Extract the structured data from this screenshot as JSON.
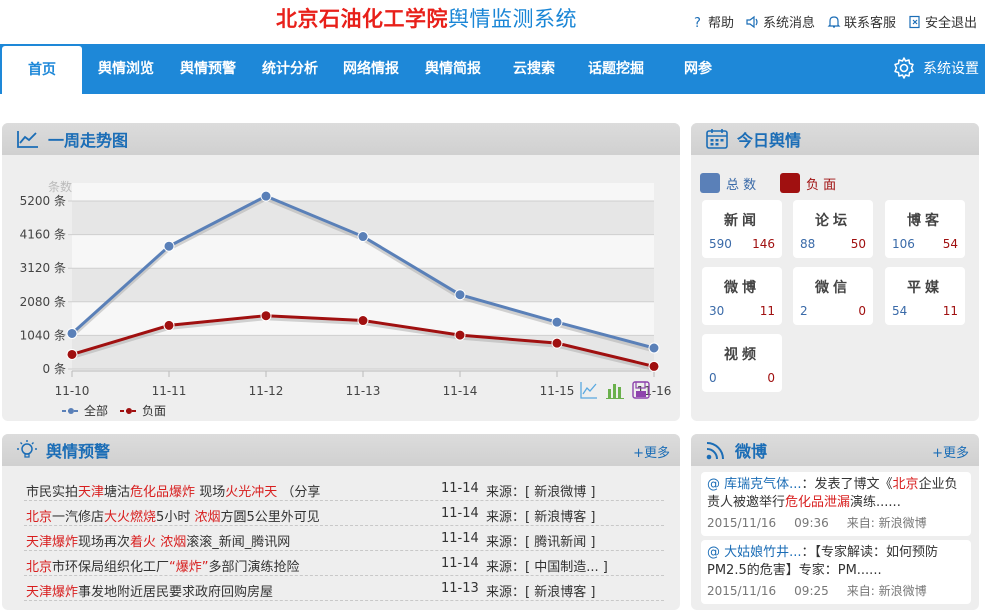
{
  "header": {
    "brand_red": "北京石油化工学院",
    "brand_blue": "舆情监测系统",
    "links": [
      "帮助",
      "系统消息",
      "联系客服",
      "安全退出"
    ]
  },
  "nav": {
    "items": [
      "首页",
      "舆情浏览",
      "舆情预警",
      "统计分析",
      "网络情报",
      "舆情简报",
      "云搜索",
      "话题挖掘",
      "网参"
    ],
    "active_index": 0,
    "settings": "系统设置"
  },
  "trend": {
    "title": "一周走势图"
  },
  "chart_data": {
    "type": "line",
    "ylabel": "条数",
    "x": [
      "11-10",
      "11-11",
      "11-12",
      "11-13",
      "11-14",
      "11-15",
      "11-16"
    ],
    "yticks": [
      "0 条",
      "1040 条",
      "2080 条",
      "3120 条",
      "4160 条",
      "5200 条"
    ],
    "ylim": [
      0,
      5200
    ],
    "series": [
      {
        "name": "全部",
        "color": "#5a80b8",
        "values": [
          1100,
          3800,
          5350,
          4100,
          2300,
          1450,
          650
        ]
      },
      {
        "name": "负面",
        "color": "#a01010",
        "values": [
          450,
          1350,
          1650,
          1500,
          1050,
          800,
          80
        ]
      }
    ],
    "grid": true,
    "legend": "bottom-left"
  },
  "today": {
    "title": "今日舆情",
    "legend_total": "总 数",
    "legend_negative": "负 面",
    "total_color": "#5a80b8",
    "negative_color": "#a01010",
    "cards": [
      {
        "name": "新闻",
        "total": "590",
        "negative": "146"
      },
      {
        "name": "论坛",
        "total": "88",
        "negative": "50"
      },
      {
        "name": "博客",
        "total": "106",
        "negative": "54"
      },
      {
        "name": "微博",
        "total": "30",
        "negative": "11"
      },
      {
        "name": "微信",
        "total": "2",
        "negative": "0"
      },
      {
        "name": "平媒",
        "total": "54",
        "negative": "11"
      },
      {
        "name": "视频",
        "total": "0",
        "negative": "0"
      }
    ]
  },
  "warning": {
    "title": "舆情预警",
    "more": "+更多",
    "rows": [
      {
        "parts": [
          [
            "市民实拍",
            false
          ],
          [
            "天津",
            true
          ],
          [
            "塘沽",
            false
          ],
          [
            "危化品爆炸",
            true
          ],
          [
            " 现场",
            false
          ],
          [
            "火光冲天",
            true
          ],
          [
            " （分享",
            false
          ]
        ],
        "date": "11-14",
        "source": "来源：[ 新浪微博 ]"
      },
      {
        "parts": [
          [
            "北京",
            true
          ],
          [
            "一汽修店",
            false
          ],
          [
            "大火燃烧",
            true
          ],
          [
            "5小时 ",
            false
          ],
          [
            "浓烟",
            true
          ],
          [
            "方圆5公里外可见",
            false
          ]
        ],
        "date": "11-14",
        "source": "来源：[ 新浪博客 ]"
      },
      {
        "parts": [
          [
            "天津爆炸",
            true
          ],
          [
            "现场再次",
            false
          ],
          [
            "着火",
            true
          ],
          [
            " ",
            false
          ],
          [
            "浓烟",
            true
          ],
          [
            "滚滚_新闻_腾讯网",
            false
          ]
        ],
        "date": "11-14",
        "source": "来源：[ 腾讯新闻 ]"
      },
      {
        "parts": [
          [
            "北京",
            true
          ],
          [
            "市环保局组织化工厂",
            false
          ],
          [
            "“爆炸”",
            true
          ],
          [
            "多部门演练抢险",
            false
          ]
        ],
        "date": "11-14",
        "source": "来源：[ 中国制造... ]"
      },
      {
        "parts": [
          [
            "天津爆炸",
            true
          ],
          [
            "事发地附近居民要求政府回购房屋",
            false
          ]
        ],
        "date": "11-13",
        "source": "来源：[ 新浪博客 ]"
      }
    ]
  },
  "weibo": {
    "title": "微博",
    "more": "+更多",
    "items": [
      {
        "user": "@ 库瑞克气体...",
        "parts": [
          [
            "：发表了博文《",
            false
          ],
          [
            "北京",
            true
          ],
          [
            "企业负责人被邀举行",
            false
          ],
          [
            "危化品泄漏",
            true
          ],
          [
            "演练......",
            false
          ]
        ],
        "date": "2015/11/16",
        "time": "09:36",
        "source": "来自: 新浪微博"
      },
      {
        "user": "@ 大姑娘竹井...",
        "parts": [
          [
            "：【专家解读：如何预防PM2.5的危害】专家：PM......",
            false
          ]
        ],
        "date": "2015/11/16",
        "time": "09:25",
        "source": "来自: 新浪微博"
      }
    ]
  }
}
